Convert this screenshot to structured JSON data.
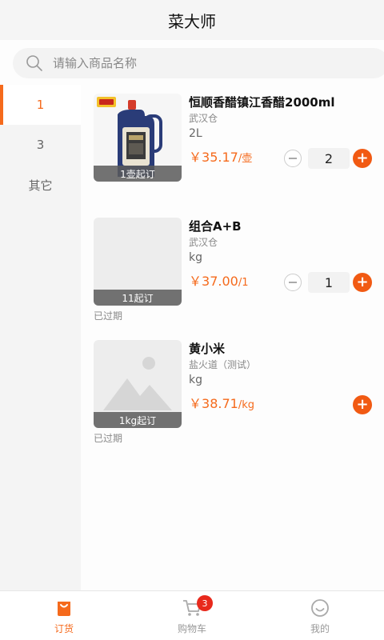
{
  "header": {
    "title": "菜大师"
  },
  "search": {
    "placeholder": "请输入商品名称"
  },
  "sidebar": {
    "items": [
      {
        "label": "1",
        "active": true
      },
      {
        "label": "3",
        "active": false
      },
      {
        "label": "其它",
        "active": false
      }
    ]
  },
  "products": [
    {
      "name": "恒顺香醋镇江香醋2000ml",
      "warehouse": "武汉仓",
      "spec": "2L",
      "currency": "￥",
      "price": "35.17",
      "unit": "/壶",
      "moq": "1壶起订",
      "quantity": "2",
      "expired": "",
      "image": "vinegar-bottle"
    },
    {
      "name": "组合A+B",
      "warehouse": "武汉仓",
      "spec": "kg",
      "currency": "￥",
      "price": "37.00",
      "unit": "/1",
      "moq": "11起订",
      "quantity": "1",
      "expired": "已过期",
      "image": "blank"
    },
    {
      "name": "黄小米",
      "warehouse": "盐火道（测试）",
      "spec": "kg",
      "currency": "￥",
      "price": "38.71",
      "unit": "/kg",
      "moq": "1kg起订",
      "quantity": "",
      "expired": "已过期",
      "image": "placeholder-image"
    }
  ],
  "tabbar": {
    "items": [
      {
        "label": "订货",
        "icon": "order-bag-icon",
        "active": true
      },
      {
        "label": "购物车",
        "icon": "cart-icon",
        "active": false,
        "badge": "3"
      },
      {
        "label": "我的",
        "icon": "smile-face-icon",
        "active": false
      }
    ]
  },
  "colors": {
    "accent": "#f56a1c",
    "plus": "#f15a13",
    "badge": "#e8291c"
  }
}
